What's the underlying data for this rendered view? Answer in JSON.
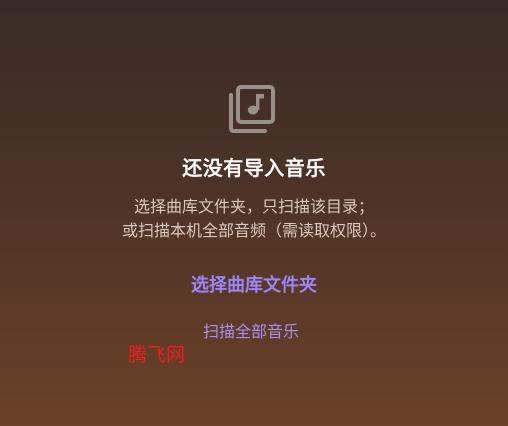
{
  "icon": "music-library-icon",
  "colors": {
    "accent": "#9a86f7",
    "link": "#a78ef0",
    "title": "#ffffff",
    "description": "#d9c9bd",
    "watermark": "#ef1e1e"
  },
  "empty_state": {
    "title": "还没有导入音乐",
    "description_line1": "选择曲库文件夹，只扫描该目录；",
    "description_line2": "或扫描本机全部音频（需读取权限）。",
    "primary_action_label": "选择曲库文件夹",
    "secondary_action_label": "扫描全部音乐"
  },
  "watermark": "腾飞网"
}
